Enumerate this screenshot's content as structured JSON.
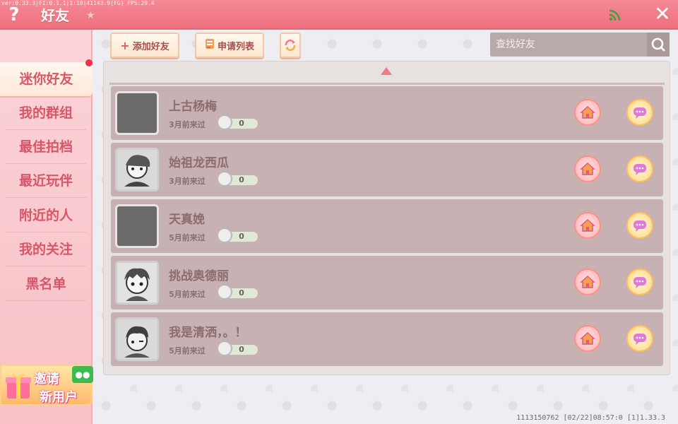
{
  "header": {
    "version": "ver:0.33.3|FI:0.1.1|1:18|41143.9[FG] FPS:29.4",
    "help_label": "?",
    "title": "好友",
    "close_label": "✕"
  },
  "sidebar": {
    "items": [
      {
        "label": "迷你好友",
        "active": true
      },
      {
        "label": "我的群组"
      },
      {
        "label": "最佳拍档"
      },
      {
        "label": "最近玩伴"
      },
      {
        "label": "附近的人"
      },
      {
        "label": "我的关注"
      },
      {
        "label": "黑名单"
      }
    ],
    "invite": {
      "line1": "邀请",
      "line2": "新用户"
    }
  },
  "toolbar": {
    "add_friend": "添加好友",
    "request_list": "申请列表",
    "refresh": "refresh-icon"
  },
  "search": {
    "placeholder": "查找好友"
  },
  "friends": [
    {
      "name": "上古杨梅",
      "last_visit": "3月前来过",
      "score": "0",
      "avatar": "blank"
    },
    {
      "name": "始祖龙西瓜",
      "last_visit": "3月前来过",
      "score": "0",
      "avatar": "portrait"
    },
    {
      "name": "天真娩",
      "last_visit": "5月前来过",
      "score": "0",
      "avatar": "blank"
    },
    {
      "name": "挑战奥德丽",
      "last_visit": "5月前来过",
      "score": "0",
      "avatar": "portrait"
    },
    {
      "name": "我是清洒，。！",
      "last_visit": "5月前来过",
      "score": "0",
      "avatar": "portrait"
    }
  ],
  "footer": {
    "info": "1113150762   [02/22]08:57:0  [1]1.33.3"
  },
  "colors": {
    "header": "#ee707e",
    "sidebar": "#f7c1c7",
    "row": "#c8b1b2",
    "accent_text": "#d7566a"
  }
}
